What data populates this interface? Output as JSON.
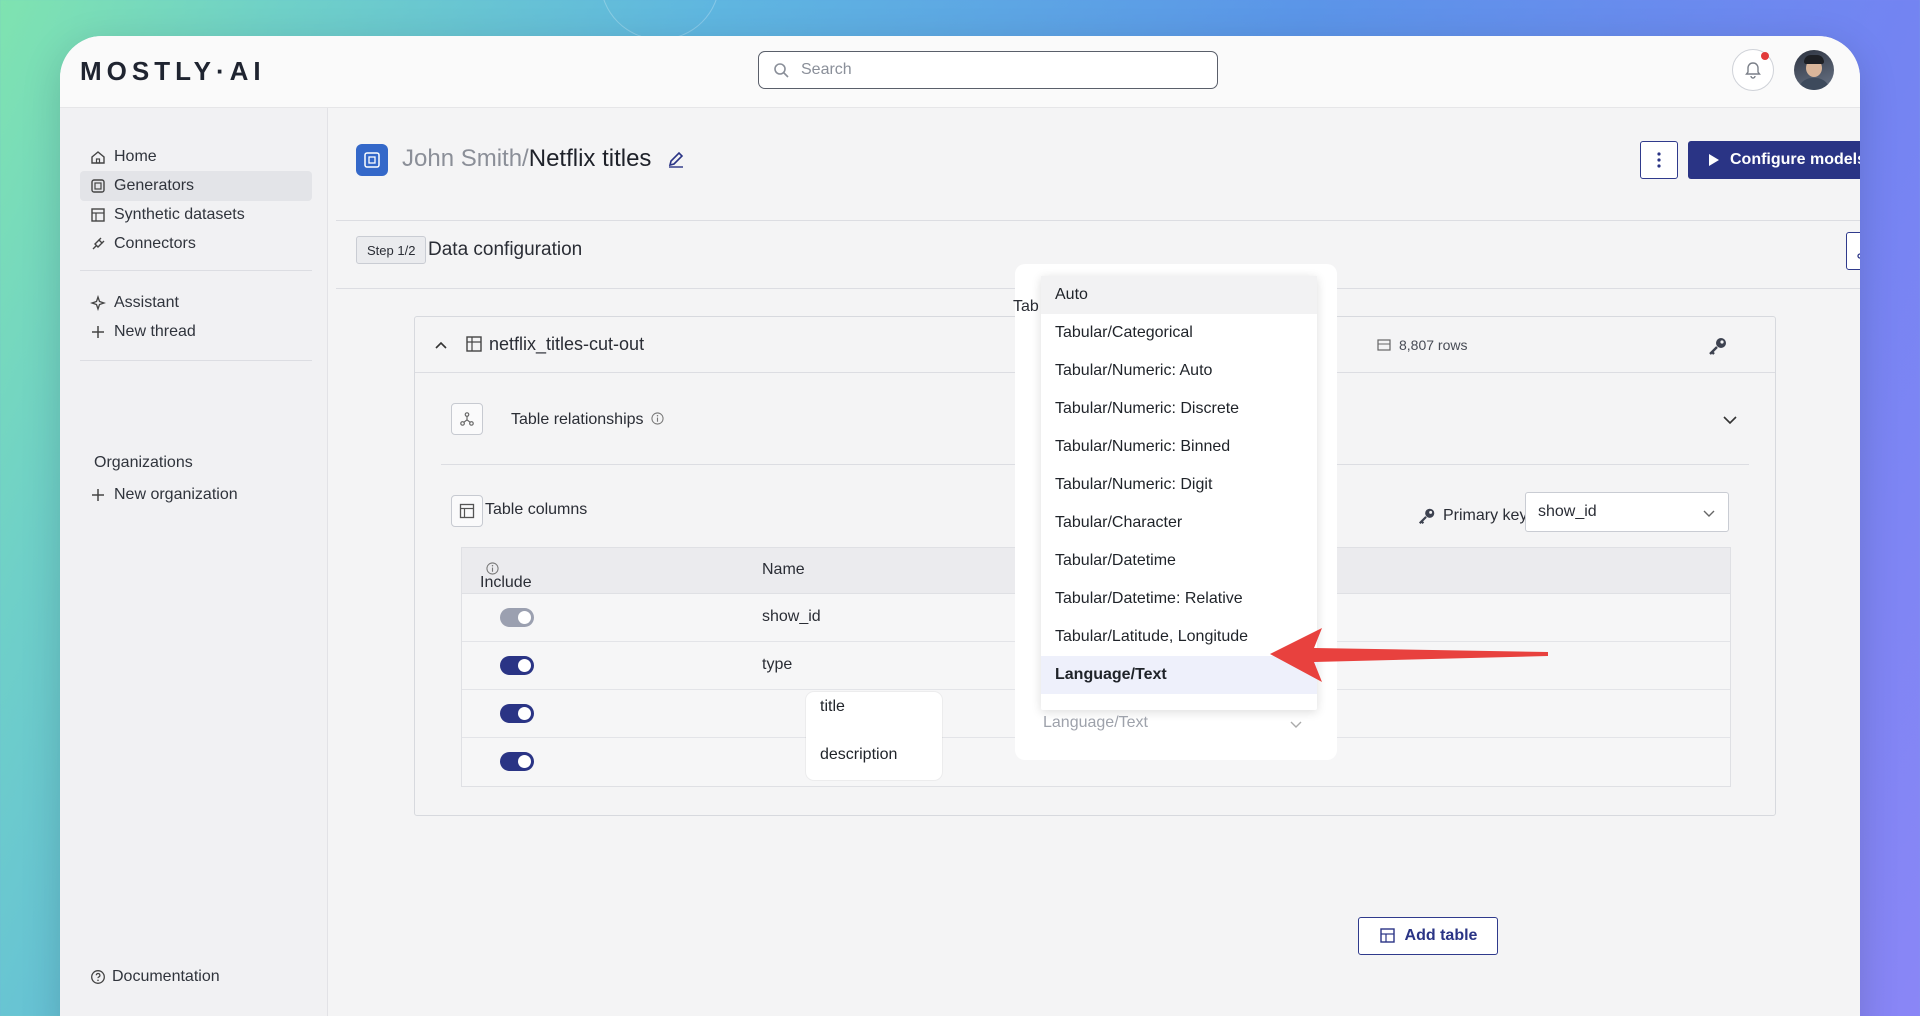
{
  "app": {
    "logo": "MOSTLY·AI",
    "search_placeholder": "Search"
  },
  "sidebar": {
    "items": [
      {
        "label": "Home",
        "icon": "home-icon"
      },
      {
        "label": "Generators",
        "icon": "generator-icon",
        "active": true
      },
      {
        "label": "Synthetic datasets",
        "icon": "dataset-icon"
      },
      {
        "label": "Connectors",
        "icon": "plug-icon"
      },
      {
        "label": "Assistant",
        "icon": "sparkle-icon"
      },
      {
        "label": "New thread",
        "icon": "plus-icon"
      }
    ],
    "organizations_title": "Organizations",
    "new_org_label": "New organization",
    "documentation_label": "Documentation"
  },
  "header": {
    "owner": "John Smith/",
    "generator_name": "Netflix titles",
    "configure_label": "Configure models",
    "step_badge": "Step 1/2",
    "step_title": "Data configuration"
  },
  "table_card": {
    "name": "netflix_titles-cut-out",
    "tab_fragment": "Tab",
    "rows": "8,807 rows",
    "relationships_label": "Table relationships",
    "columns_label": "Table columns",
    "primary_key_label": "Primary key",
    "primary_key_value": "show_id",
    "headers": {
      "include": "Include",
      "name": "Name"
    },
    "columns": [
      {
        "name": "show_id",
        "included": true,
        "locked": true
      },
      {
        "name": "type",
        "included": true
      },
      {
        "name": "title",
        "included": true
      },
      {
        "name": "description",
        "included": true,
        "encoding": "Language/Text"
      }
    ]
  },
  "dropdown": {
    "options": [
      "Auto",
      "Tabular/Categorical",
      "Tabular/Numeric: Auto",
      "Tabular/Numeric: Discrete",
      "Tabular/Numeric: Binned",
      "Tabular/Numeric: Digit",
      "Tabular/Character",
      "Tabular/Datetime",
      "Tabular/Datetime: Relative",
      "Tabular/Latitude, Longitude",
      "Language/Text"
    ],
    "selected": "Language/Text",
    "hovered": "Auto"
  },
  "add_table_label": "Add table",
  "colors": {
    "primary": "#2a3485",
    "accent_blue": "#3468c9",
    "arrow_red": "#e8413e",
    "notification_dot": "#e23a3a"
  }
}
